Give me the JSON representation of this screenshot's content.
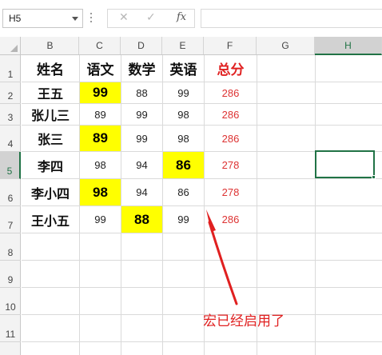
{
  "formula_bar": {
    "name_box": "H5",
    "cancel_glyph": "✕",
    "enter_glyph": "✓",
    "function_label": "fx",
    "formula_value": ""
  },
  "columns": [
    "B",
    "C",
    "D",
    "E",
    "F",
    "G",
    "H"
  ],
  "selected_column": "H",
  "rows": [
    "1",
    "2",
    "3",
    "4",
    "5",
    "6",
    "7",
    "8",
    "9",
    "10",
    "11"
  ],
  "selected_row": "5",
  "table": {
    "headers": [
      "姓名",
      "语文",
      "数学",
      "英语",
      "总分"
    ],
    "data": [
      [
        "王五",
        "99",
        "88",
        "99",
        "286"
      ],
      [
        "张儿三",
        "89",
        "99",
        "98",
        "286"
      ],
      [
        "张三",
        "89",
        "99",
        "98",
        "286"
      ],
      [
        "李四",
        "98",
        "94",
        "86",
        "278"
      ],
      [
        "李小四",
        "98",
        "94",
        "86",
        "278"
      ],
      [
        "王小五",
        "99",
        "88",
        "99",
        "286"
      ]
    ]
  },
  "colors": {
    "highlight": "#ffff00",
    "total_text": "#d33333",
    "header_total": "#e02020",
    "selection": "#217346",
    "annotation": "#e02020"
  },
  "annotation": {
    "text": "宏已经启用了"
  }
}
